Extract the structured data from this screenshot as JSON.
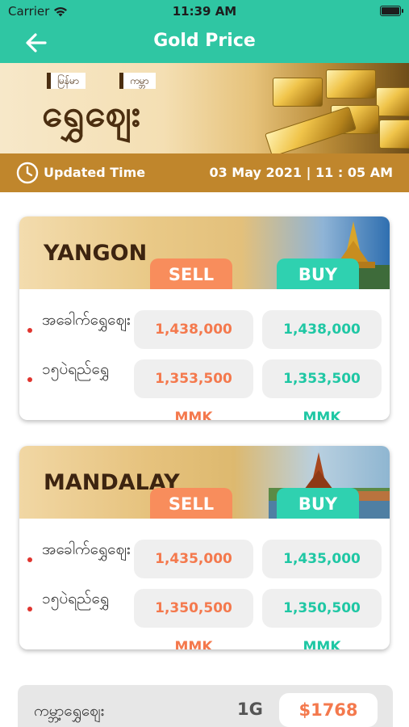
{
  "status_bar": {
    "carrier": "Carrier",
    "time": "11:39 AM",
    "wifi_icon": "wifi-icon",
    "battery_icon": "battery-icon"
  },
  "nav": {
    "title": "Gold Price",
    "back_icon": "back-arrow-icon"
  },
  "banner": {
    "tag_left": "မြန်မာ",
    "tag_right": "ကမ္ဘာ",
    "headline": "ရွှေဈေး"
  },
  "updated": {
    "label": "Updated Time",
    "value": "03 May 2021 | 11 : 05 AM",
    "clock_icon": "clock-icon"
  },
  "cities": [
    {
      "name": "YANGON",
      "sell_label": "SELL",
      "buy_label": "BUY",
      "rows": [
        {
          "name": "အခေါက်ရွှေဈေး",
          "sell": "1,438,000 MMK",
          "buy": "1,438,000 MMK"
        },
        {
          "name": "၁၅ပဲရည်ရွှေ",
          "sell": "1,353,500 MMK",
          "buy": "1,353,500 MMK"
        }
      ]
    },
    {
      "name": "MANDALAY",
      "sell_label": "SELL",
      "buy_label": "BUY",
      "rows": [
        {
          "name": "အခေါက်ရွှေဈေး",
          "sell": "1,435,000 MMK",
          "buy": "1,435,000 MMK"
        },
        {
          "name": "၁၅ပဲရည်ရွှေ",
          "sell": "1,350,500 MMK",
          "buy": "1,350,500 MMK"
        }
      ]
    }
  ],
  "world": {
    "label": "ကမ္ဘာ့ရွှေဈေး",
    "unit": "1G",
    "price": "$1768"
  },
  "colors": {
    "header": "#2fc6a3",
    "updated_bar": "#c0862c",
    "sell": "#f4794d",
    "buy": "#1fc7a4"
  }
}
